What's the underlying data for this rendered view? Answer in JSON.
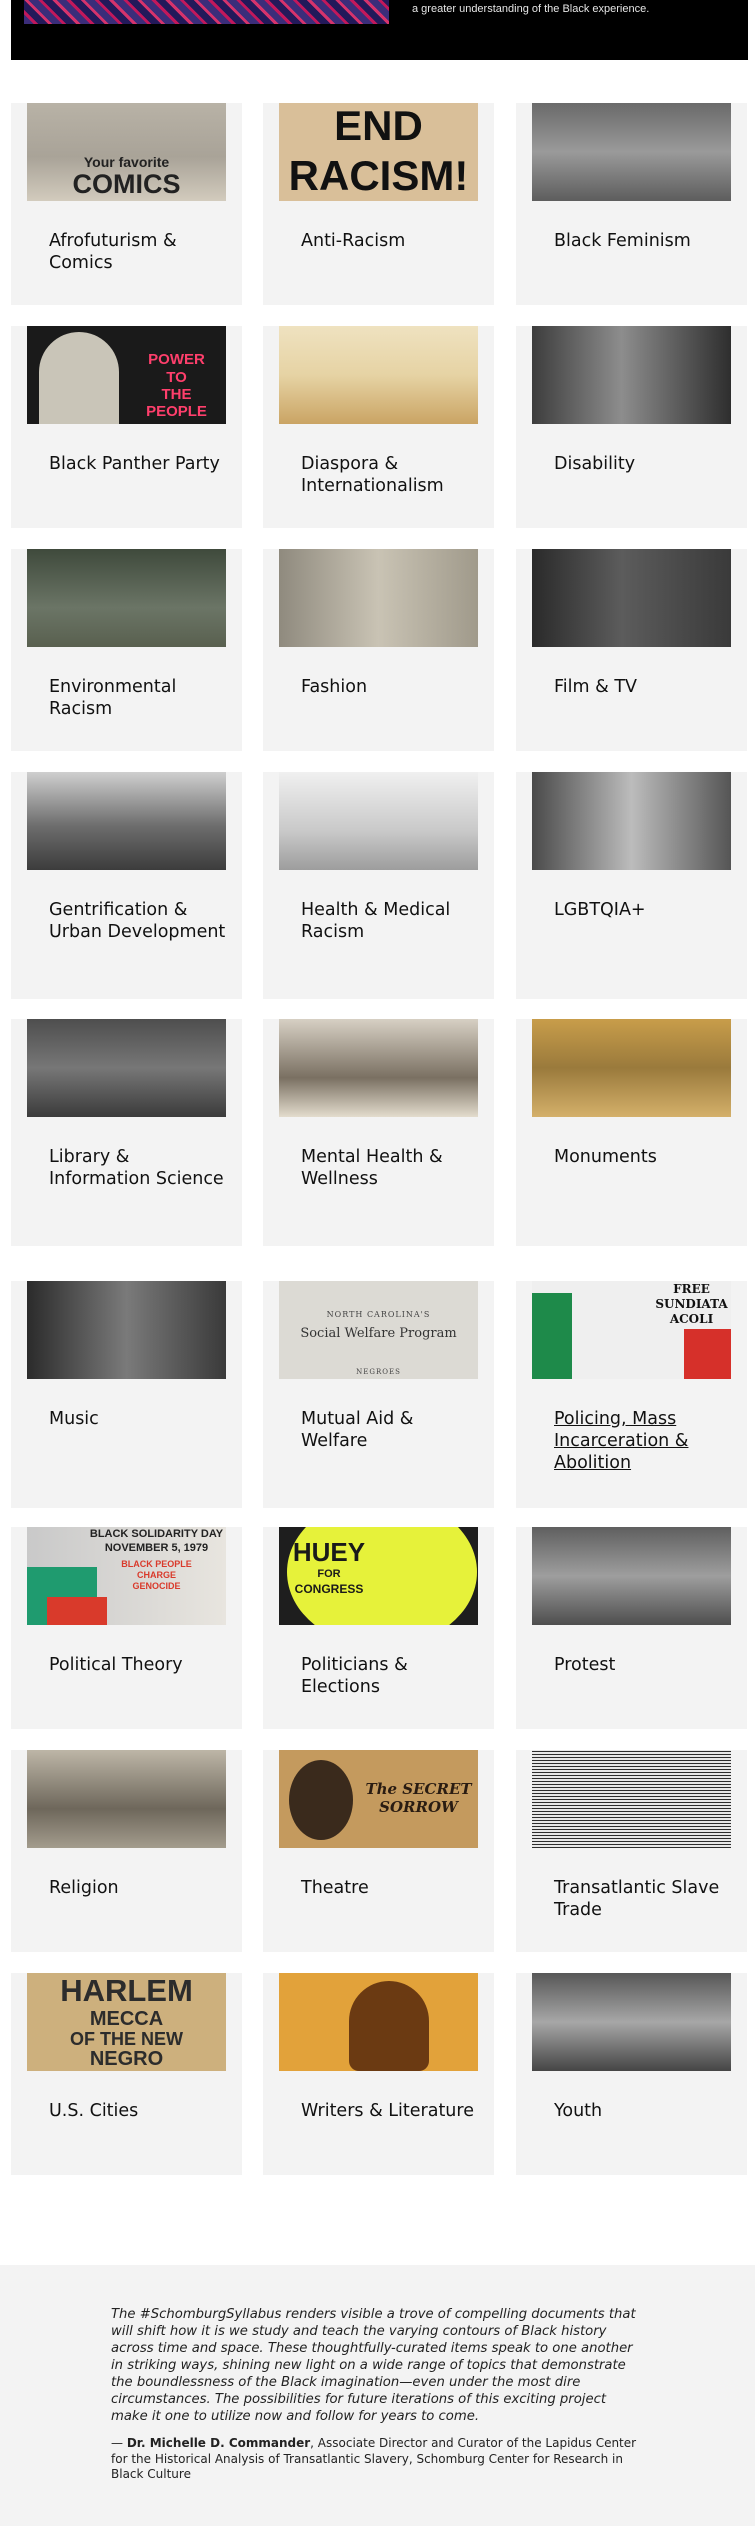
{
  "hero": {
    "tagline": "a greater understanding of the Black experience."
  },
  "topics": [
    {
      "label": "Afrofuturism & Comics",
      "image": "comics-covers-photo",
      "thumb_text": [
        "Your favorite",
        "COMICS"
      ]
    },
    {
      "label": "Anti-Racism",
      "image": "end-racism-poster",
      "thumb_text": [
        "END",
        "RACISM!"
      ]
    },
    {
      "label": "Black Feminism",
      "image": "women-at-table-photo",
      "thumb_text": []
    },
    {
      "label": "Black Panther Party",
      "image": "power-to-the-people-poster",
      "thumb_text": [
        "POWER",
        "TO",
        "THE",
        "PEOPLE"
      ]
    },
    {
      "label": "Diaspora & Internationalism",
      "image": "desert-caravan-painting",
      "thumb_text": []
    },
    {
      "label": "Disability",
      "image": "medical-examination-photo",
      "thumb_text": []
    },
    {
      "label": "Environmental Racism",
      "image": "field-workers-photo",
      "thumb_text": []
    },
    {
      "label": "Fashion",
      "image": "woman-portrait-photo",
      "thumb_text": []
    },
    {
      "label": "Film & TV",
      "image": "man-in-front-of-shop-photo",
      "thumb_text": []
    },
    {
      "label": "Gentrification & Urban Development",
      "image": "city-street-photo",
      "thumb_text": []
    },
    {
      "label": "Health & Medical Racism",
      "image": "hospital-ward-photo",
      "thumb_text": []
    },
    {
      "label": "LGBTQIA+",
      "image": "performers-photo",
      "thumb_text": []
    },
    {
      "label": "Library & Information Science",
      "image": "library-office-photo",
      "thumb_text": []
    },
    {
      "label": "Mental Health & Wellness",
      "image": "outdoor-gathering-photo",
      "thumb_text": []
    },
    {
      "label": "Monuments",
      "image": "monument-stereograph",
      "thumb_text": []
    },
    {
      "label": "Music",
      "image": "saxophonist-photo",
      "thumb_text": []
    },
    {
      "label": "Mutual Aid & Welfare",
      "image": "social-welfare-document",
      "thumb_text": [
        "NORTH CAROLINA'S",
        "Social Welfare Program",
        "NEGROES"
      ]
    },
    {
      "label": "Policing, Mass Incarceration & Abolition",
      "image": "free-sundiata-poster",
      "thumb_text": [
        "FREE",
        "SUNDIATA",
        "ACOLI"
      ]
    },
    {
      "label": "Political Theory",
      "image": "black-solidarity-day-poster",
      "thumb_text": [
        "BLACK SOLIDARITY DAY",
        "NOVEMBER 5, 1979",
        "BLACK PEOPLE",
        "CHARGE",
        "GENOCIDE"
      ]
    },
    {
      "label": "Politicians & Elections",
      "image": "huey-for-congress-button",
      "thumb_text": [
        "HUEY",
        "FOR",
        "CONGRESS"
      ]
    },
    {
      "label": "Protest",
      "image": "seated-protester-photo",
      "thumb_text": []
    },
    {
      "label": "Religion",
      "image": "figures-mural-drawing",
      "thumb_text": []
    },
    {
      "label": "Theatre",
      "image": "secret-sorrow-playbill",
      "thumb_text": [
        "The SECRET",
        "SORROW"
      ]
    },
    {
      "label": "Transatlantic Slave Trade",
      "image": "kneeling-figure-engraving",
      "thumb_text": []
    },
    {
      "label": "U.S. Cities",
      "image": "harlem-mecca-poster",
      "thumb_text": [
        "HARLEM",
        "MECCA",
        "OF THE NEW",
        "NEGRO"
      ]
    },
    {
      "label": "Writers & Literature",
      "image": "journal-cover-portrait",
      "thumb_text": []
    },
    {
      "label": "Youth",
      "image": "children-in-classroom-photo",
      "thumb_text": []
    }
  ],
  "footer": {
    "quote": "The #SchomburgSyllabus renders visible a trove of compelling documents that will shift how it is we study and teach the varying contours of Black history across time and space. These thoughtfully-curated items speak to one another in striking ways, shining new light on a wide range of topics that demonstrate the boundlessness of the Black imagination—even under the most dire circumstances. The possibilities for future iterations of this exciting project make it one to utilize now and follow for years to come.",
    "attribution_prefix": "— ",
    "attribution_name": "Dr. Michelle D. Commander",
    "attribution_role": ", Associate Director and Curator of the Lapidus Center for the Historical Analysis of Transatlantic Slavery, Schomburg Center for Research in Black Culture"
  }
}
